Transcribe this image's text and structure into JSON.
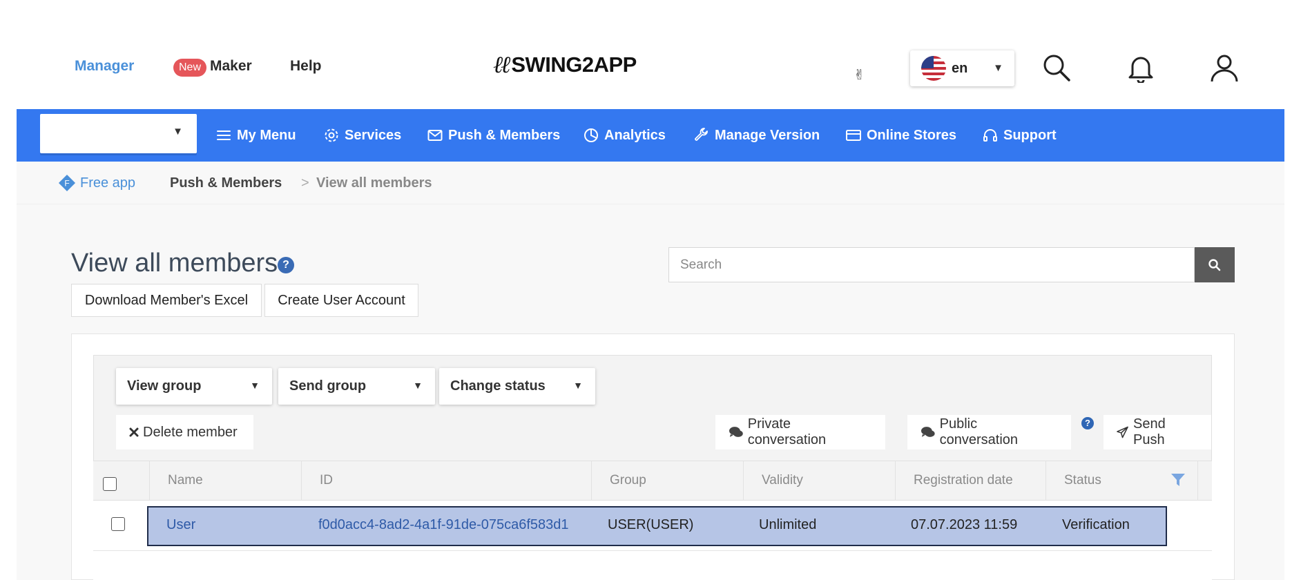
{
  "header": {
    "links": {
      "manager": "Manager",
      "new_badge": "New",
      "maker": "Maker",
      "help": "Help"
    },
    "logo": "SWING2APP",
    "language": {
      "code": "en"
    }
  },
  "nav": {
    "items": [
      {
        "label": "My Menu",
        "icon": "menu-icon"
      },
      {
        "label": "Services",
        "icon": "gear-icon"
      },
      {
        "label": "Push & Members",
        "icon": "mail-icon"
      },
      {
        "label": "Analytics",
        "icon": "pie-chart-icon"
      },
      {
        "label": "Manage Version",
        "icon": "wrench-icon"
      },
      {
        "label": "Online Stores",
        "icon": "card-icon"
      },
      {
        "label": "Support",
        "icon": "headset-icon"
      }
    ]
  },
  "breadcrumb": {
    "badge": "F",
    "free_app": "Free app",
    "section": "Push & Members",
    "separator": ">",
    "current": "View all members"
  },
  "page": {
    "title": "View all members",
    "help": "?",
    "download_excel": "Download Member's Excel",
    "create_account": "Create User Account",
    "search_placeholder": "Search"
  },
  "toolbar": {
    "view_group": "View group",
    "send_group": "Send group",
    "change_status": "Change status",
    "delete_member": "Delete member",
    "private_conversation": "Private conversation",
    "public_conversation": "Public conversation",
    "help": "?",
    "send_push": "Send Push"
  },
  "table": {
    "columns": [
      "Name",
      "ID",
      "Group",
      "Validity",
      "Registration date",
      "Status"
    ],
    "rows": [
      {
        "name": "User",
        "id": "f0d0acc4-8ad2-4a1f-91de-075ca6f583d1",
        "group": "USER(USER)",
        "validity": "Unlimited",
        "registration_date": "07.07.2023 11:59",
        "status": "Verification"
      }
    ]
  },
  "colors": {
    "nav_blue": "#3478f0",
    "selected_row": "#b6c5e6",
    "manager_link": "#4a90d9"
  }
}
